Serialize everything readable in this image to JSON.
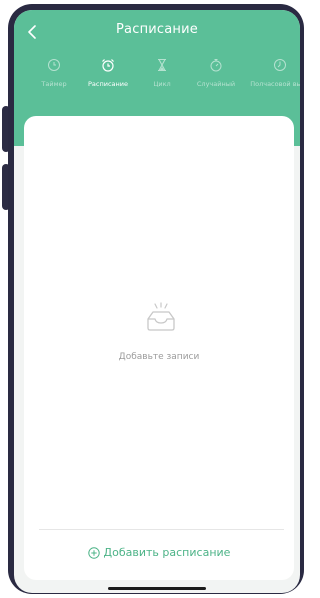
{
  "header": {
    "title": "Расписание",
    "accent_color": "#5bbf98"
  },
  "tabs": [
    {
      "label": "Таймер",
      "icon": "clock-icon",
      "active": false
    },
    {
      "label": "Расписание",
      "icon": "alarm-clock-icon",
      "active": true
    },
    {
      "label": "Цикл",
      "icon": "hourglass-icon",
      "active": false
    },
    {
      "label": "Случайный",
      "icon": "stopwatch-icon",
      "active": false
    },
    {
      "label": "Полчасовой выкл",
      "icon": "clock-icon",
      "active": false
    }
  ],
  "empty_state": {
    "icon": "empty-inbox-icon",
    "text": "Добавьте записи"
  },
  "footer": {
    "add_label": "Добавить расписание",
    "add_icon": "plus-circle-icon",
    "add_color": "#4cb387"
  }
}
